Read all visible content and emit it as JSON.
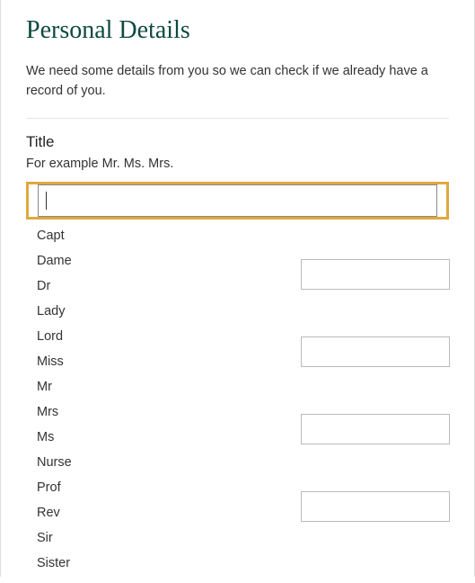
{
  "header": {
    "title": "Personal Details",
    "intro": "We need some details from you so we can check if we already have a record of you."
  },
  "fields": {
    "title": {
      "label": "Title",
      "hint": "For example Mr. Ms. Mrs.",
      "value": "",
      "options": [
        "Capt",
        "Dame",
        "Dr",
        "Lady",
        "Lord",
        "Miss",
        "Mr",
        "Mrs",
        "Ms",
        "Nurse",
        "Prof",
        "Rev",
        "Sir",
        "Sister"
      ]
    }
  },
  "secondaryInputsCount": 4
}
